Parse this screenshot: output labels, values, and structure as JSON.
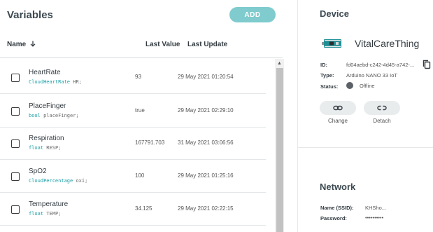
{
  "variables": {
    "title": "Variables",
    "add_label": "ADD",
    "columns": {
      "name": "Name",
      "last_value": "Last Value",
      "last_update": "Last Update"
    },
    "rows": [
      {
        "name": "HeartRate",
        "type": "CloudHeartRate",
        "var": "HR;",
        "value": "93",
        "updated": "29 May 2021 01:20:54"
      },
      {
        "name": "PlaceFinger",
        "type": "bool",
        "var": "placeFinger;",
        "value": "true",
        "updated": "29 May 2021 02:29:10"
      },
      {
        "name": "Respiration",
        "type": "float",
        "var": "RESP;",
        "value": "167791.703",
        "updated": "31 May 2021 03:06:56"
      },
      {
        "name": "SpO2",
        "type": "CloudPercentage",
        "var": "oxi;",
        "value": "100",
        "updated": "29 May 2021 01:25:16"
      },
      {
        "name": "Temperature",
        "type": "float",
        "var": "TEMP;",
        "value": "34.125",
        "updated": "29 May 2021 02:22:15"
      }
    ]
  },
  "device": {
    "title": "Device",
    "thing_name": "VitalCareThing",
    "id_label": "ID:",
    "id_value": "fd04aebd-c242-4d45-a742-...",
    "type_label": "Type:",
    "type_value": "Arduino NANO 33 IoT",
    "status_label": "Status:",
    "status_value": "Offline",
    "change_label": "Change",
    "detach_label": "Detach"
  },
  "network": {
    "title": "Network",
    "ssid_label": "Name (SSID):",
    "ssid_value": "KHSho...",
    "password_label": "Password:",
    "password_value": "••••••••••"
  },
  "colors": {
    "accent": "#7fcbcd",
    "type_text": "#1aa0a8",
    "status_offline": "#5b6166"
  }
}
